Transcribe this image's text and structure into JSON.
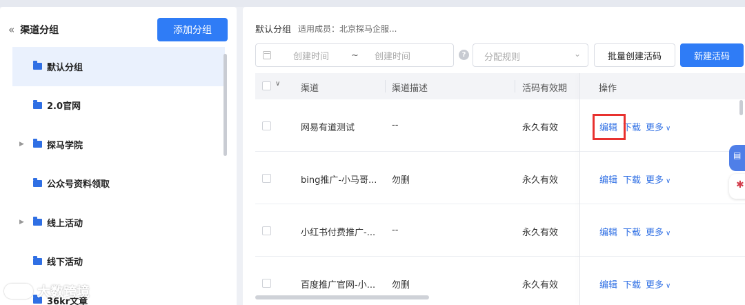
{
  "sidebar": {
    "collapse_icon": "double-chevron-left-icon",
    "title": "渠道分组",
    "add_button": "添加分组",
    "groups": [
      {
        "label": "默认分组",
        "active": true,
        "expandable": false
      },
      {
        "label": "2.0官网",
        "active": false,
        "expandable": false
      },
      {
        "label": "探马学院",
        "active": false,
        "expandable": true
      },
      {
        "label": "公众号资料领取",
        "active": false,
        "expandable": false
      },
      {
        "label": "线上活动",
        "active": false,
        "expandable": true
      },
      {
        "label": "线下活动",
        "active": false,
        "expandable": false
      },
      {
        "label": "36kr文章",
        "active": false,
        "expandable": false
      }
    ]
  },
  "header": {
    "group_name": "默认分组",
    "members": "适用成员：北京探马企服..."
  },
  "filters": {
    "start_placeholder": "创建时间",
    "separator": "~",
    "end_placeholder": "创建时间",
    "rule_placeholder": "分配规则",
    "batch_button": "批量创建活码",
    "new_button": "新建活码"
  },
  "table": {
    "columns": [
      "渠道",
      "渠道描述",
      "活码有效期",
      "操作"
    ],
    "rows": [
      {
        "channel": "网易有道测试",
        "desc": "--",
        "validity": "永久有效"
      },
      {
        "channel": "bing推广-小马哥...",
        "desc": "勿删",
        "validity": "永久有效"
      },
      {
        "channel": "小红书付费推广-...",
        "desc": "--",
        "validity": "永久有效"
      },
      {
        "channel": "百度推广官网-小...",
        "desc": "勿删",
        "validity": "永久有效"
      }
    ],
    "actions": {
      "edit": "编辑",
      "download": "下载",
      "more": "更多"
    }
  },
  "watermark": {
    "text": "大数跨境"
  },
  "colors": {
    "primary": "#2f7cf6",
    "highlight": "#e8312f",
    "folder": "#2f6fe4"
  }
}
